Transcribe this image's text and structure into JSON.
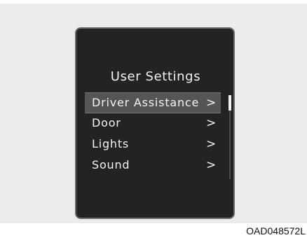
{
  "screen": {
    "title": "User Settings",
    "menu": [
      {
        "label": "Driver Assistance",
        "chevron": ">",
        "selected": true
      },
      {
        "label": "Door",
        "chevron": ">",
        "selected": false
      },
      {
        "label": "Lights",
        "chevron": ">",
        "selected": false
      },
      {
        "label": "Sound",
        "chevron": ">",
        "selected": false
      }
    ],
    "scroll_position_fraction": 0.0
  },
  "caption": "OAD048572L",
  "colors": {
    "screen_bg": "#232323",
    "highlight": "#555555",
    "text": "#f4f4f4"
  }
}
